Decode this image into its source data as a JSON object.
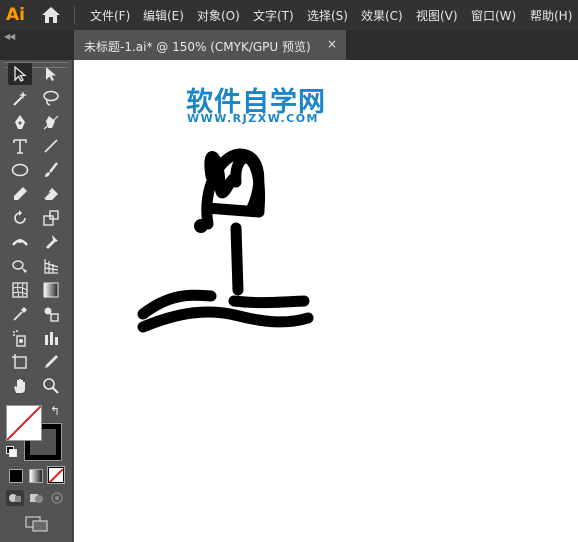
{
  "app": {
    "logo_text": "Ai"
  },
  "menu": {
    "items": [
      "文件(F)",
      "编辑(E)",
      "对象(O)",
      "文字(T)",
      "选择(S)",
      "效果(C)",
      "视图(V)",
      "窗口(W)",
      "帮助(H)"
    ]
  },
  "document": {
    "tab_title": "未标题-1.ai* @ 150% (CMYK/GPU 预览)",
    "close_glyph": "×"
  },
  "watermark": {
    "title": "软件自学网",
    "url": "WWW.RJZXW.COM",
    "color": "#1a86c8"
  },
  "tools": {
    "icons": [
      "selection-tool-icon",
      "direct-selection-tool-icon",
      "magic-wand-tool-icon",
      "lasso-tool-icon",
      "pen-tool-icon",
      "curvature-tool-icon",
      "type-tool-icon",
      "line-segment-tool-icon",
      "ellipse-tool-icon",
      "paintbrush-tool-icon",
      "shaper-tool-icon",
      "eraser-tool-icon",
      "rotate-tool-icon",
      "scale-tool-icon",
      "width-tool-icon",
      "puppet-warp-tool-icon",
      "shape-builder-tool-icon",
      "perspective-grid-tool-icon",
      "mesh-tool-icon",
      "gradient-tool-icon",
      "eyedropper-tool-icon",
      "blend-tool-icon",
      "symbol-sprayer-tool-icon",
      "column-graph-tool-icon",
      "artboard-tool-icon",
      "slice-tool-icon",
      "hand-tool-icon",
      "zoom-tool-icon"
    ],
    "fill_stroke": {
      "fill": "none",
      "stroke": "#000000"
    }
  },
  "colors": {
    "menubar": "#323232",
    "panel": "#535353",
    "canvas": "#ffffff",
    "accent_logo": "#ff9a00"
  }
}
